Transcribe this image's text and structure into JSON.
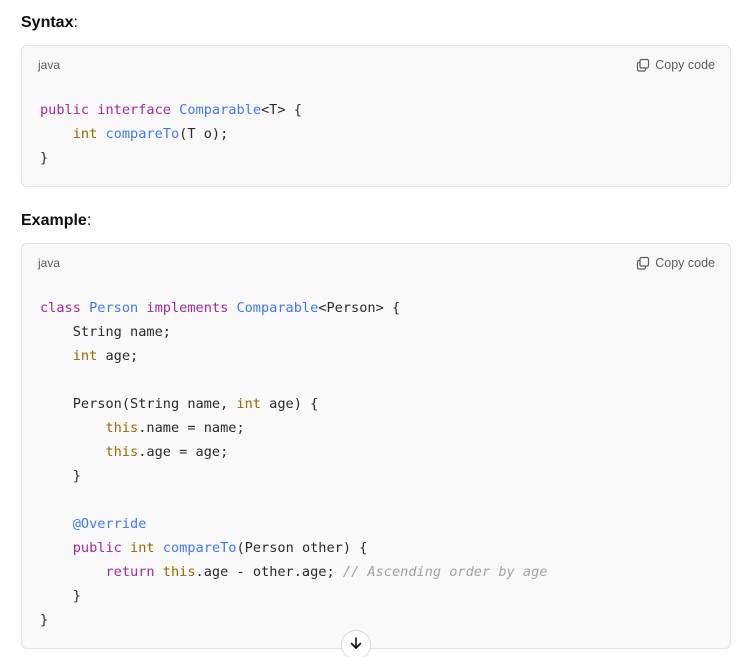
{
  "syntax_section": {
    "heading": "Syntax",
    "colon": ":",
    "language": "java",
    "copy_label": "Copy code",
    "lines": [
      [
        {
          "t": "kw",
          "v": "public"
        },
        {
          "t": "",
          "v": " "
        },
        {
          "t": "kw",
          "v": "interface"
        },
        {
          "t": "",
          "v": " "
        },
        {
          "t": "ty",
          "v": "Comparable"
        },
        {
          "t": "",
          "v": "<T> {"
        }
      ],
      [
        {
          "t": "",
          "v": "    "
        },
        {
          "t": "pr",
          "v": "int"
        },
        {
          "t": "",
          "v": " "
        },
        {
          "t": "fn",
          "v": "compareTo"
        },
        {
          "t": "",
          "v": "(T o);"
        }
      ],
      [
        {
          "t": "",
          "v": "}"
        }
      ]
    ]
  },
  "example_section": {
    "heading": "Example",
    "colon": ":",
    "language": "java",
    "copy_label": "Copy code",
    "lines": [
      [
        {
          "t": "kw",
          "v": "class"
        },
        {
          "t": "",
          "v": " "
        },
        {
          "t": "ty",
          "v": "Person"
        },
        {
          "t": "",
          "v": " "
        },
        {
          "t": "kw",
          "v": "implements"
        },
        {
          "t": "",
          "v": " "
        },
        {
          "t": "ty",
          "v": "Comparable"
        },
        {
          "t": "",
          "v": "<Person> {"
        }
      ],
      [
        {
          "t": "",
          "v": "    String name;"
        }
      ],
      [
        {
          "t": "",
          "v": "    "
        },
        {
          "t": "pr",
          "v": "int"
        },
        {
          "t": "",
          "v": " age;"
        }
      ],
      [
        {
          "t": "",
          "v": ""
        }
      ],
      [
        {
          "t": "",
          "v": "    Person(String name, "
        },
        {
          "t": "pr",
          "v": "int"
        },
        {
          "t": "",
          "v": " age) {"
        }
      ],
      [
        {
          "t": "",
          "v": "        "
        },
        {
          "t": "th",
          "v": "this"
        },
        {
          "t": "",
          "v": ".name = name;"
        }
      ],
      [
        {
          "t": "",
          "v": "        "
        },
        {
          "t": "th",
          "v": "this"
        },
        {
          "t": "",
          "v": ".age = age;"
        }
      ],
      [
        {
          "t": "",
          "v": "    }"
        }
      ],
      [
        {
          "t": "",
          "v": ""
        }
      ],
      [
        {
          "t": "",
          "v": "    "
        },
        {
          "t": "an",
          "v": "@Override"
        }
      ],
      [
        {
          "t": "",
          "v": "    "
        },
        {
          "t": "kw",
          "v": "public"
        },
        {
          "t": "",
          "v": " "
        },
        {
          "t": "pr",
          "v": "int"
        },
        {
          "t": "",
          "v": " "
        },
        {
          "t": "fn",
          "v": "compareTo"
        },
        {
          "t": "",
          "v": "(Person other) {"
        }
      ],
      [
        {
          "t": "",
          "v": "        "
        },
        {
          "t": "kw",
          "v": "return"
        },
        {
          "t": "",
          "v": " "
        },
        {
          "t": "th",
          "v": "this"
        },
        {
          "t": "",
          "v": ".age - other.age; "
        },
        {
          "t": "cm",
          "v": "// Ascending order by age"
        }
      ],
      [
        {
          "t": "",
          "v": "    }"
        }
      ],
      [
        {
          "t": "",
          "v": "}"
        }
      ]
    ]
  },
  "icons": {
    "copy": "copy-icon",
    "scroll_down": "arrow-down-icon"
  }
}
